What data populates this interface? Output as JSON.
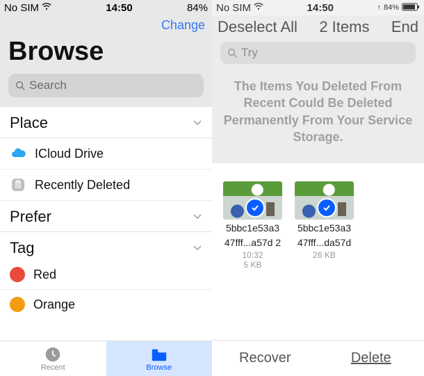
{
  "left": {
    "status": {
      "carrier": "No SIM",
      "time": "14:50",
      "battery": "84%"
    },
    "header_link": "Change",
    "title": "Browse",
    "search_placeholder": "Search",
    "sections": {
      "place": {
        "label": "Place",
        "items": [
          {
            "label": "ICloud Drive",
            "icon": "cloud"
          },
          {
            "label": "Recently Deleted",
            "icon": "trash"
          }
        ]
      },
      "prefer": {
        "label": "Prefer"
      },
      "tag": {
        "label": "Tag",
        "items": [
          {
            "label": "Red",
            "color": "#e84b3c"
          },
          {
            "label": "Orange",
            "color": "#f39c12"
          }
        ]
      }
    },
    "tabs": {
      "recent": "Recent",
      "browse": "Browse"
    }
  },
  "right": {
    "status": {
      "carrier": "No SIM",
      "time": "14:50",
      "battery": "84%"
    },
    "header": {
      "deselect": "Deselect All",
      "count": "2 Items",
      "end": "End"
    },
    "search_placeholder": "Try",
    "info": "The Items You Deleted From Recent Could Be Deleted Permanently From Your Service Storage.",
    "items": [
      {
        "name1": "5bbc1e53a3",
        "name2": "47fff...a57d 2",
        "time": "10:32",
        "size": "5 KB"
      },
      {
        "name1": "5bbc1e53a3",
        "name2": "47fff...da57d",
        "time": "",
        "size": "26 KB"
      }
    ],
    "actions": {
      "recover": "Recover",
      "delete": "Delete"
    }
  }
}
